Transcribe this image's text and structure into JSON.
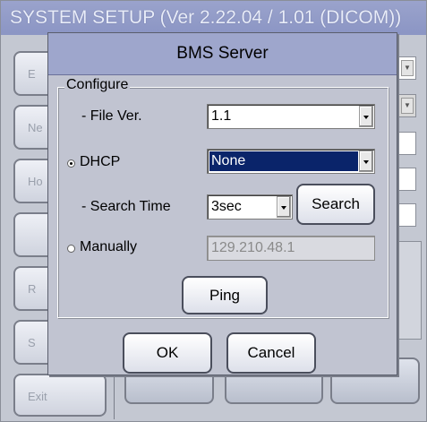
{
  "background": {
    "title": "SYSTEM SETUP (Ver 2.22.04 / 1.01 (DICOM))",
    "side_buttons": [
      {
        "label": "E"
      },
      {
        "label": "Ne"
      },
      {
        "label": "Ho"
      },
      {
        "label": ""
      },
      {
        "label": "R"
      },
      {
        "label": "S"
      },
      {
        "label": "Exit"
      }
    ]
  },
  "dialog": {
    "title": "BMS Server",
    "group_label": "Configure",
    "file_ver": {
      "label": "- File Ver.",
      "value": "1.1"
    },
    "dhcp": {
      "label": "DHCP",
      "selected": true,
      "value": "None"
    },
    "search_time": {
      "label": "- Search Time",
      "value": "3sec",
      "button_label": "Search"
    },
    "manually": {
      "label": "Manually",
      "selected": false,
      "ip_value": "129.210.48.1"
    },
    "ping_label": "Ping",
    "ok_label": "OK",
    "cancel_label": "Cancel"
  }
}
